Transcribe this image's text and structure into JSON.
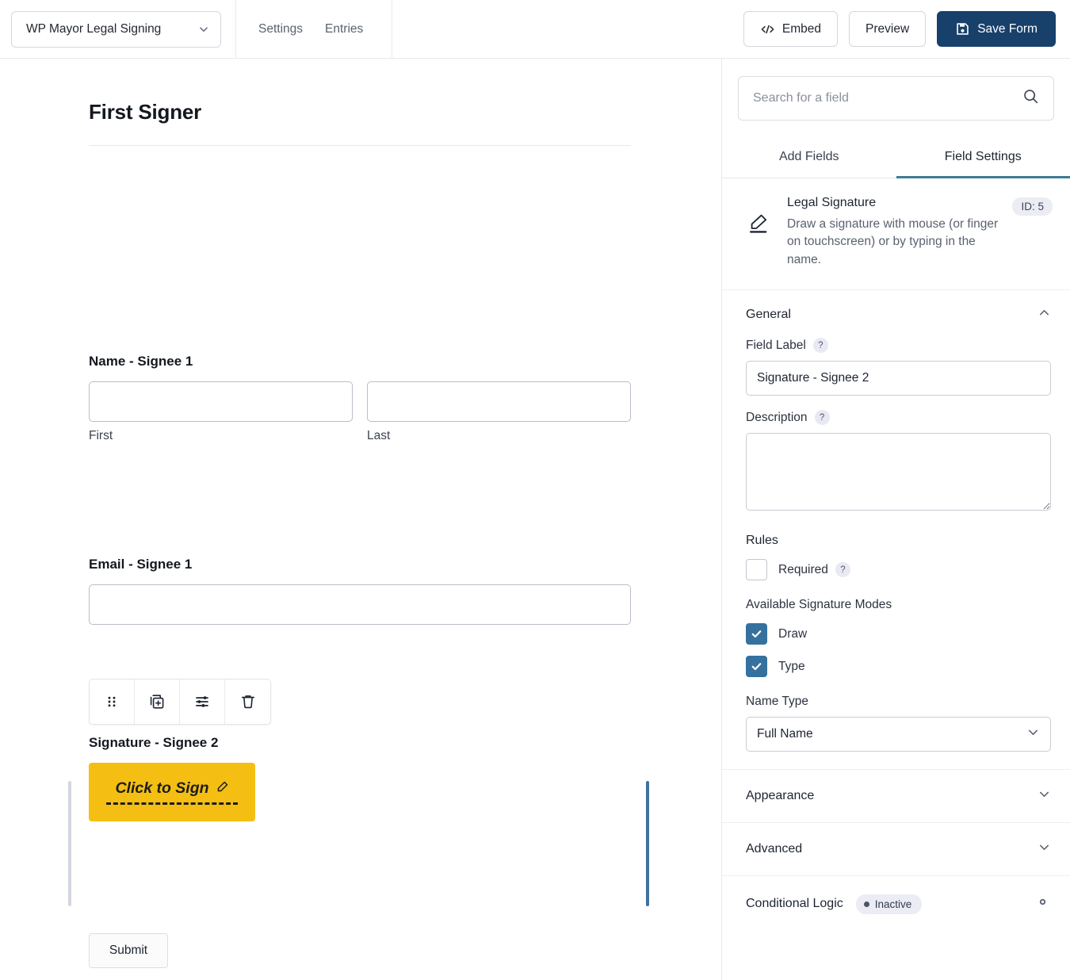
{
  "topbar": {
    "form_selector": {
      "value": "WP Mayor Legal Signing",
      "icon": "chevron-down-icon"
    },
    "nav": [
      {
        "label": "Settings"
      },
      {
        "label": "Entries"
      }
    ],
    "actions": {
      "embed_label": "Embed",
      "embed_icon": "code-icon",
      "preview_label": "Preview",
      "save_label": "Save Form",
      "save_icon": "floppy-disk-icon",
      "primary_color": "#17406b"
    }
  },
  "canvas": {
    "form_title": "First Signer",
    "fields": [
      {
        "label": "Name - Signee 1",
        "type": "name",
        "sub_first": "First",
        "sub_last": "Last",
        "first_value": "",
        "last_value": ""
      },
      {
        "label": "Email - Signee 1",
        "type": "email",
        "value": ""
      }
    ],
    "signature_field": {
      "label": "Signature - Signee 2",
      "button_text": "Click to Sign",
      "button_icon": "pen-nib-icon",
      "button_color": "#f4bf12",
      "selected_bar_color": "#3e719f",
      "toolbar": [
        {
          "name": "drag-handle-icon",
          "title": "Move"
        },
        {
          "name": "duplicate-icon",
          "title": "Duplicate"
        },
        {
          "name": "sliders-icon",
          "title": "Settings"
        },
        {
          "name": "trash-icon",
          "title": "Delete"
        }
      ]
    },
    "submit_label": "Submit"
  },
  "panel": {
    "search": {
      "placeholder": "Search for a field",
      "value": "",
      "icon": "search-icon"
    },
    "tabs": [
      {
        "label": "Add Fields",
        "active": false
      },
      {
        "label": "Field Settings",
        "active": true
      }
    ],
    "active_tab_color": "#3e7c93",
    "field_info": {
      "icon": "pen-nib-icon",
      "title": "Legal Signature",
      "description": "Draw a signature with mouse (or finger on touchscreen) or by typing in the name.",
      "id_badge": "ID: 5"
    },
    "general": {
      "heading": "General",
      "collapse_icon": "chevron-up-icon",
      "field_label_label": "Field Label",
      "field_label_help": "?",
      "field_label_value": "Signature - Signee 2",
      "description_label": "Description",
      "description_help": "?",
      "description_value": "",
      "rules_heading": "Rules",
      "required_label": "Required",
      "required_help": "?",
      "required_checked": false,
      "modes_heading": "Available Signature Modes",
      "modes": [
        {
          "label": "Draw",
          "checked": true
        },
        {
          "label": "Type",
          "checked": true
        }
      ],
      "checkbox_color": "#35719e",
      "name_type_label": "Name Type",
      "name_type_value": "Full Name",
      "name_type_icon": "chevron-down-icon"
    },
    "highlight": {
      "color": "#f32735"
    },
    "sections": [
      {
        "label": "Appearance",
        "icon": "chevron-down-icon"
      },
      {
        "label": "Advanced",
        "icon": "chevron-down-icon"
      }
    ],
    "conditional_logic": {
      "label": "Conditional Logic",
      "status": "Inactive",
      "gear_icon": "gear-icon"
    }
  }
}
